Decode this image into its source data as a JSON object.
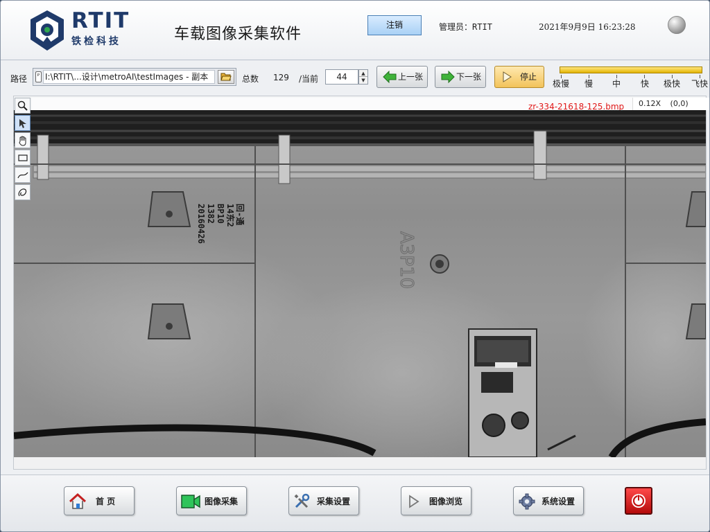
{
  "header": {
    "brand_main": "RTIT",
    "brand_sub": "铁检科技",
    "app_title": "车载图像采集软件",
    "logout_label": "注销",
    "admin_label": "管理员：",
    "admin_name": "RTIT",
    "datetime": "2021年9月9日  16:23:28"
  },
  "toolbar": {
    "path_label": "路径",
    "path_value": "I:\\RTIT\\...设计\\metroAI\\testImages - 副本",
    "total_label": "总数",
    "total_value": "129",
    "current_label": "/当前",
    "current_value": "44",
    "prev_label": "上一张",
    "next_label": "下一张",
    "stop_label": "停止",
    "speed_labels": [
      "极慢",
      "慢",
      "中",
      "快",
      "极快",
      "飞快"
    ]
  },
  "viewer": {
    "filename": "zr-334-21618-125.bmp",
    "zoom": "0.12X",
    "coord": "(0,0)",
    "tools": [
      "zoom-tool",
      "pointer-tool",
      "pan-tool",
      "rectangle-tool",
      "line-tool",
      "freehand-tool"
    ],
    "image_markings": {
      "stencil_left": [
        "回-通",
        "14东2",
        "BP10",
        "1382",
        "20160426"
      ],
      "stencil_center": "A3P10"
    }
  },
  "footer": {
    "home_label": "首    页",
    "capture_label": "图像采集",
    "capture_settings_label": "采集设置",
    "browse_label": "图像浏览",
    "system_settings_label": "系统设置"
  },
  "colors": {
    "brand": "#1f3a6a",
    "filename_red": "#e01818",
    "logout_blue": "#a9d1f5",
    "stop_yellow": "#f2c35a",
    "power_red": "#c41212"
  }
}
